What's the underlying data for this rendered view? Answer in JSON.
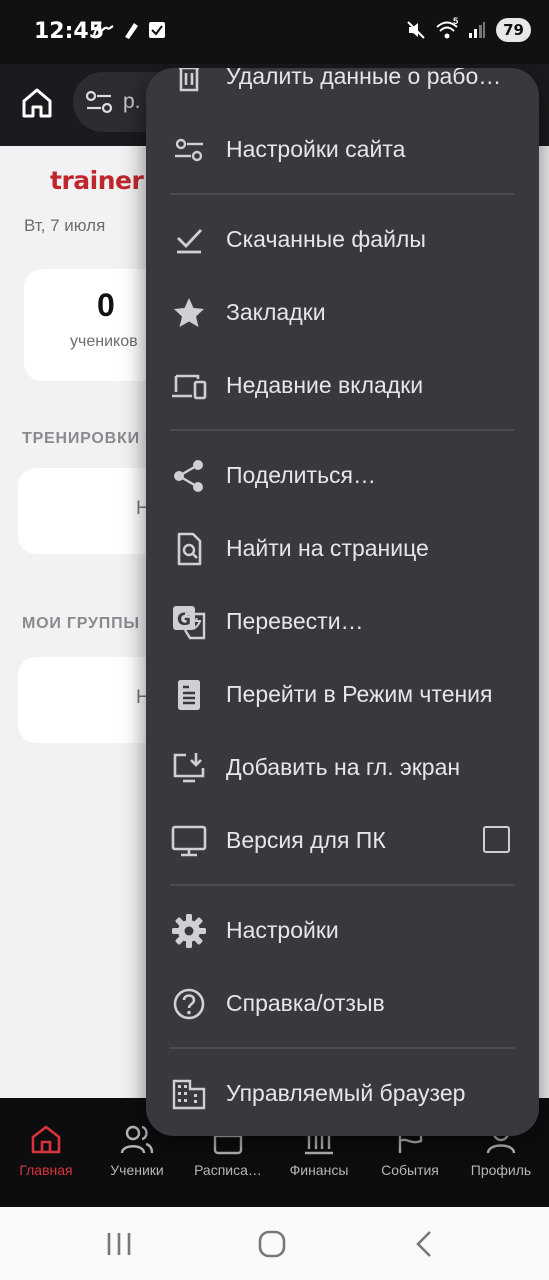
{
  "status_bar": {
    "time": "12:45",
    "battery": "79",
    "wifi_badge": "5"
  },
  "toolbar": {
    "url_fragment": "p.",
    "home_icon": "home-icon",
    "site_settings_icon": "tune-icon"
  },
  "page": {
    "logo": "trainer",
    "date": "Вт, 7 июля",
    "stats": [
      {
        "value": "0",
        "label": "учеников"
      }
    ],
    "sections": [
      {
        "title": "ТРЕНИРОВКИ С",
        "card_text": "Н"
      },
      {
        "title": "МОИ ГРУППЫ",
        "card_text": "Н"
      }
    ]
  },
  "menu": {
    "items": [
      {
        "label": "Удалить данные о рабо…",
        "icon": "trash-icon"
      },
      {
        "label": "Настройки сайта",
        "icon": "tune-icon"
      },
      {
        "label": "Скачанные файлы",
        "icon": "download-done-icon"
      },
      {
        "label": "Закладки",
        "icon": "star-icon"
      },
      {
        "label": "Недавние вкладки",
        "icon": "devices-icon"
      },
      {
        "label": "Поделиться…",
        "icon": "share-icon"
      },
      {
        "label": "Найти на странице",
        "icon": "find-in-page-icon"
      },
      {
        "label": "Перевести…",
        "icon": "translate-icon"
      },
      {
        "label": "Перейти в Режим чтения",
        "icon": "reader-mode-icon"
      },
      {
        "label": "Добавить на гл. экран",
        "icon": "add-to-home-icon"
      },
      {
        "label": "Версия для ПК",
        "icon": "desktop-icon",
        "checked": false
      },
      {
        "label": "Настройки",
        "icon": "gear-icon"
      },
      {
        "label": "Справка/отзыв",
        "icon": "help-icon"
      },
      {
        "label": "Управляемый браузер",
        "icon": "managed-browser-icon"
      }
    ]
  },
  "tabbar": {
    "tabs": [
      {
        "label": "Главная",
        "icon": "home-icon",
        "active": true
      },
      {
        "label": "Ученики",
        "icon": "users-icon",
        "active": false
      },
      {
        "label": "Расписа…",
        "icon": "calendar-icon",
        "active": false
      },
      {
        "label": "Финансы",
        "icon": "finance-icon",
        "active": false
      },
      {
        "label": "События",
        "icon": "flag-icon",
        "active": false
      },
      {
        "label": "Профиль",
        "icon": "profile-icon",
        "active": false
      }
    ]
  },
  "colors": {
    "accent": "#d8343c",
    "menu_bg": "#38383e",
    "menu_text": "#e6e6ea",
    "page_bg": "#f2f2f4"
  }
}
